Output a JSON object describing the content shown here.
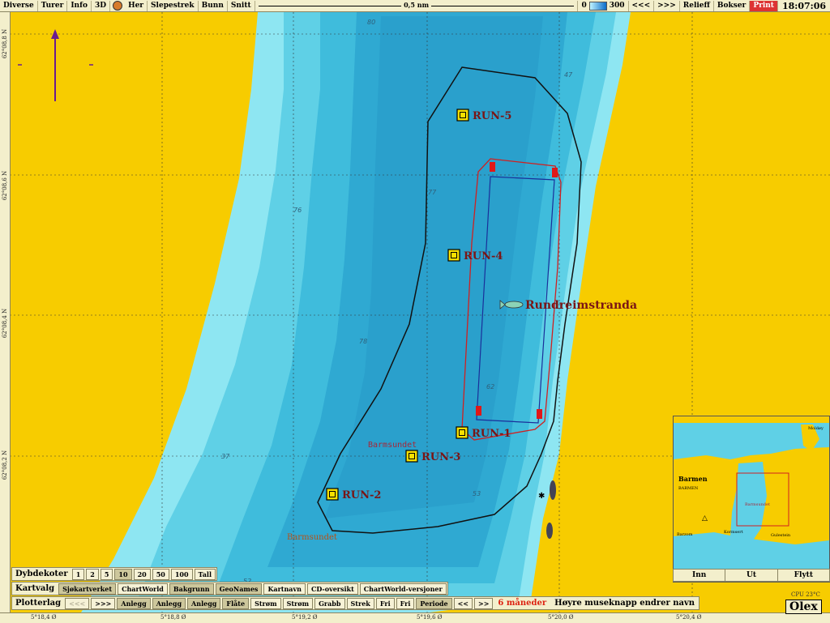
{
  "toolbar": {
    "items": [
      "Diverse",
      "Turer",
      "Info",
      "3D",
      "Her",
      "Slepestrek",
      "Bunn",
      "Snitt"
    ],
    "scale_label": "0,5 nm",
    "depth_min": "0",
    "depth_max": "300",
    "nav_back": "<<<",
    "nav_fwd": ">>>",
    "relieff": "Relieff",
    "bokser": "Bokser",
    "print": "Print",
    "time": "18:07:06"
  },
  "axes": {
    "longitudes": [
      "5°18,4 Ø",
      "5°18,8 Ø",
      "5°19,2 Ø",
      "5°19,6 Ø",
      "5°20,0 Ø",
      "5°20,4 Ø"
    ],
    "latitudes": [
      "62°08,8 N",
      "62°08,6 N",
      "62°08,4 N",
      "62°08,2 N"
    ]
  },
  "map": {
    "place_name": "Rundreimstranda",
    "sound_name": "Barmsundet",
    "sound_name_2": "Barmsundet",
    "runs": [
      "RUN-5",
      "RUN-4",
      "RUN-1",
      "RUN-3",
      "RUN-2"
    ],
    "depths": [
      "80",
      "47",
      "77",
      "76",
      "78",
      "62",
      "53",
      "52",
      "37",
      "17"
    ]
  },
  "dybdekoter": {
    "label": "Dybdekoter",
    "options": [
      "1",
      "2",
      "5",
      "10",
      "20",
      "50",
      "100",
      "Tall"
    ]
  },
  "kartvalg": {
    "label": "Kartvalg",
    "options": [
      "Sjøkartverket",
      "ChartWorld",
      "Bakgrunn",
      "GeoNames",
      "Kartnavn",
      "CD-oversikt",
      "ChartWorld-versjoner"
    ]
  },
  "plotterlag": {
    "label": "Plotterlag",
    "back": "<<<",
    "fwd": ">>>",
    "options": [
      "Anlegg",
      "Anlegg",
      "Anlegg",
      "Flåte",
      "Strøm",
      "Strøm",
      "Grabb",
      "Strek",
      "Fri",
      "Fri"
    ],
    "periode": "Periode",
    "prev": "<<",
    "next": ">>",
    "period_value": "6 måneder",
    "hint": "Høyre museknapp endrer navn"
  },
  "minimap": {
    "place_upper": "Barmen",
    "place_upper_caps": "BARMEN",
    "place_mid": "Barmsundet",
    "place_left": "Barzom",
    "place_kor": "Kormsert",
    "place_right": "Gulestein",
    "place_corner": "Moldøy",
    "buttons": [
      "Inn",
      "Ut",
      "Flytt"
    ]
  },
  "status": {
    "cpu": "CPU 23°C",
    "brand": "Olex"
  }
}
